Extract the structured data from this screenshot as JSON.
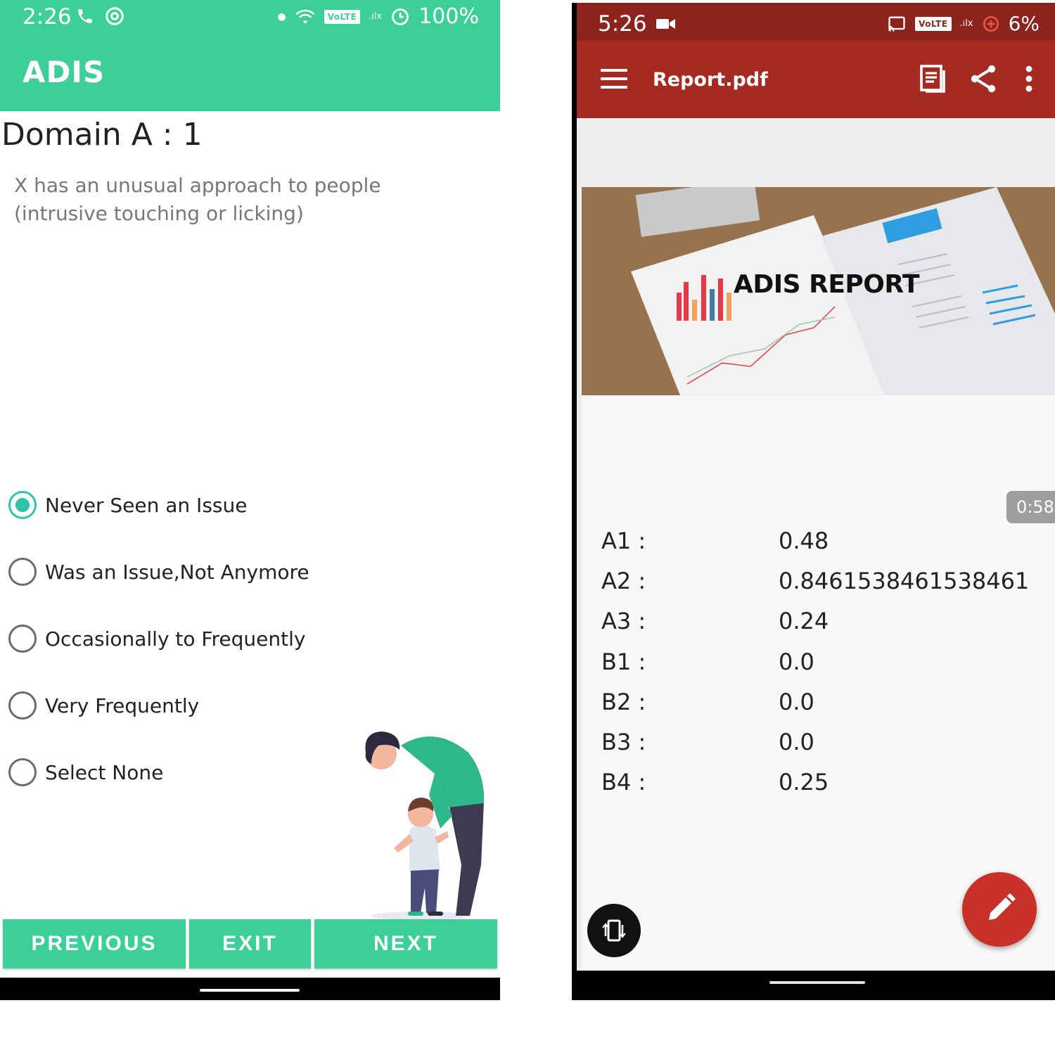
{
  "left_screen": {
    "status_bar": {
      "time": "2:26",
      "volte": "VoLTE",
      "signal": ".ılx",
      "battery": "100%"
    },
    "app_bar": {
      "title": "ADIS"
    },
    "question": {
      "heading": "Domain A : 1",
      "text": "X has an unusual approach to people (intrusive touching or licking)"
    },
    "options": [
      {
        "label": "Never Seen an Issue",
        "selected": true
      },
      {
        "label": "Was an Issue,Not Anymore",
        "selected": false
      },
      {
        "label": "Occasionally to Frequently",
        "selected": false
      },
      {
        "label": "Very Frequently",
        "selected": false
      },
      {
        "label": "Select None",
        "selected": false
      }
    ],
    "buttons": {
      "previous": "PREVIOUS",
      "exit": "EXIT",
      "next": "NEXT"
    },
    "colors": {
      "primary": "#3ccf9a",
      "radio_accent": "#2ec4a6"
    }
  },
  "right_screen": {
    "status_bar": {
      "time": "5:26",
      "volte": "VoLTE",
      "signal": ".ılx",
      "battery": "6%"
    },
    "toolbar": {
      "file_title": "Report.pdf"
    },
    "banner": {
      "title": "ADIS REPORT"
    },
    "timer": "0:58",
    "scores": [
      {
        "label": "A1 :",
        "value": "0.48"
      },
      {
        "label": "A2 :",
        "value": "0.8461538461538461"
      },
      {
        "label": "A3 :",
        "value": "0.24"
      },
      {
        "label": "B1 :",
        "value": "0.0"
      },
      {
        "label": "B2 :",
        "value": "0.0"
      },
      {
        "label": "B3 :",
        "value": "0.0"
      },
      {
        "label": "B4 :",
        "value": "0.25"
      }
    ],
    "colors": {
      "status_bar": "#8c231c",
      "toolbar": "#a52a22",
      "fab": "#c9302a"
    }
  }
}
